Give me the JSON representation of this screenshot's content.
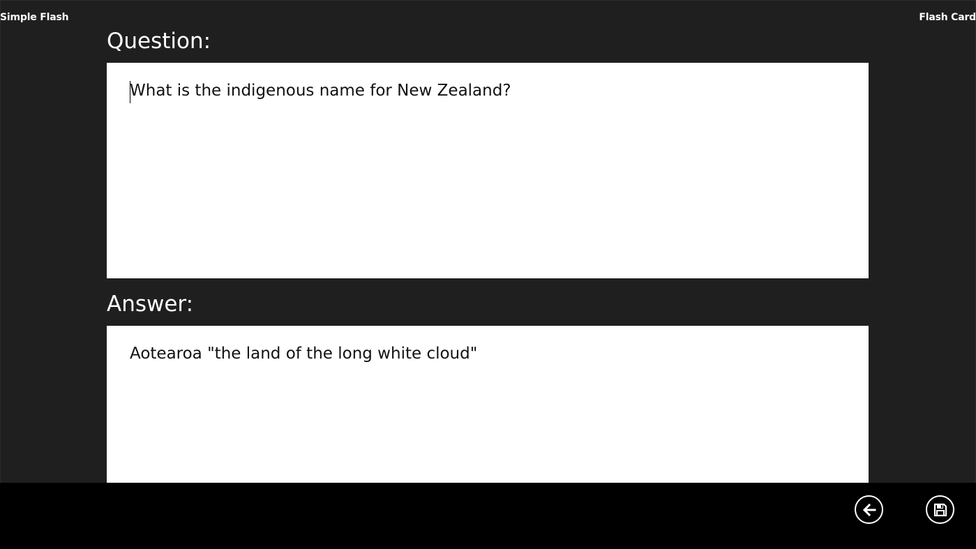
{
  "app": {
    "title": "Simple Flash",
    "page_label": "Flash Card"
  },
  "question": {
    "heading": "Question:",
    "value": "What is the indigenous name for New Zealand?"
  },
  "answer": {
    "heading": "Answer:",
    "value": "Aotearoa \"the land of the long white cloud\""
  },
  "app_bar": {
    "buttons": [
      {
        "icon": "back-arrow-icon"
      },
      {
        "icon": "save-icon"
      }
    ]
  },
  "colors": {
    "background": "#1f1f1f",
    "app_bar": "#000000",
    "card": "#ffffff",
    "text_light": "#ffffff",
    "text_dark": "#111111"
  }
}
